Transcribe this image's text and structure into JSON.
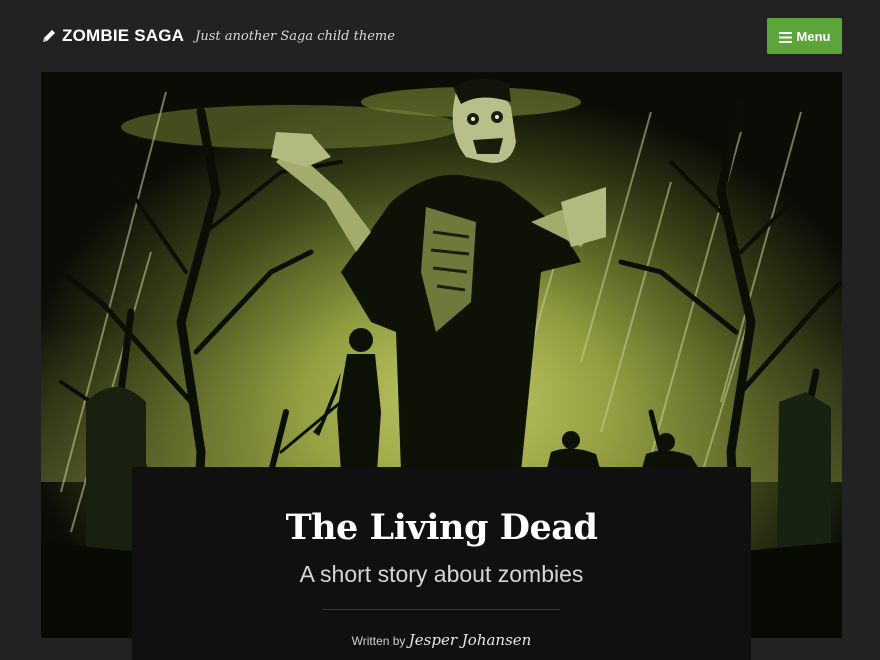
{
  "header": {
    "site_title": "ZOMBIE SAGA",
    "tagline": "Just another Saga child theme",
    "menu_label": "Menu",
    "icons": [
      "pencil-icon",
      "hamburger-icon"
    ]
  },
  "post": {
    "title": "The Living Dead",
    "subtitle": "A short story about zombies",
    "written_by": "Written by",
    "author": "Jesper Johansen"
  },
  "colors": {
    "background": "#222222",
    "menu_button": "#5ba53a",
    "card": "#101010",
    "hero_glow": "#9aa845"
  }
}
